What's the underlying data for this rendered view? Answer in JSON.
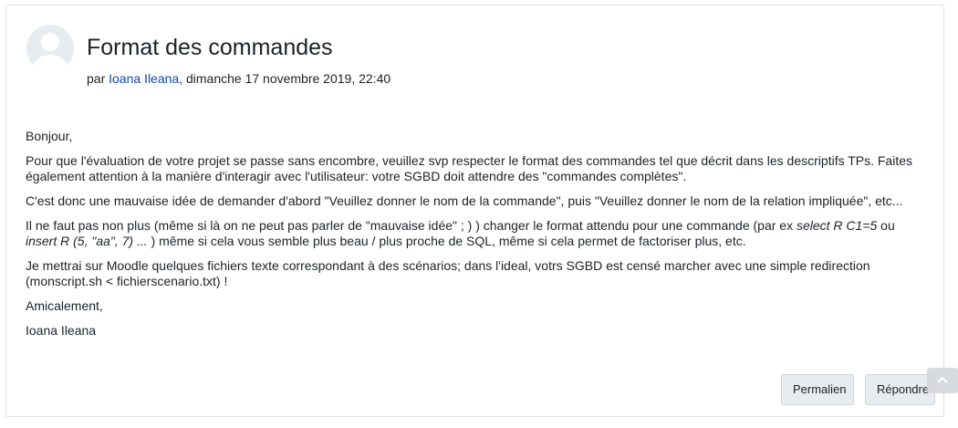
{
  "post": {
    "title": "Format des commandes",
    "byline_prefix": "par ",
    "author": "Ioana Ileana",
    "date": ", dimanche 17 novembre 2019, 22:40",
    "greeting": "Bonjour,",
    "p1": "Pour que l'évaluation de votre projet se passe sans encombre, veuillez svp respecter le format des commandes tel que décrit dans les descriptifs TPs. Faites également attention à la manière d'interagir avec l'utilisateur: votre SGBD doit attendre des \"commandes complètes\".",
    "p2": "C'est donc une mauvaise idée de demander d'abord \"Veuillez donner le nom de la commande\", puis \"Veuillez donner le nom de la relation impliquée\", etc...",
    "p3_a": "Il ne faut pas non plus (même si là on ne peut pas parler de \"mauvaise idée\" ; ) ) changer le format attendu pour une commande (par ex ",
    "p3_em1": "select R C1=5",
    "p3_b": " ou ",
    "p3_em2": "insert R (5, \"aa\", 7) ...",
    "p3_c": " ) même si cela vous semble plus beau / plus proche de SQL, même si cela permet de factoriser plus, etc.",
    "p4": "Je mettrai sur Moodle quelques fichiers texte correspondant à des scénarios; dans l'ideal, votrs SGBD est censé marcher avec une simple redirection (monscript.sh < fichierscenario.txt) !",
    "closing": "Amicalement,",
    "signature": "Ioana Ileana"
  },
  "actions": {
    "permalink_label": "Permalien",
    "reply_label": "Répondre"
  },
  "icons": {
    "avatar": "user-avatar-icon",
    "scroll_top": "chevron-up-icon"
  },
  "colors": {
    "link": "#0f47ad",
    "border": "#dee2e6",
    "button_bg": "#e9ecef"
  }
}
